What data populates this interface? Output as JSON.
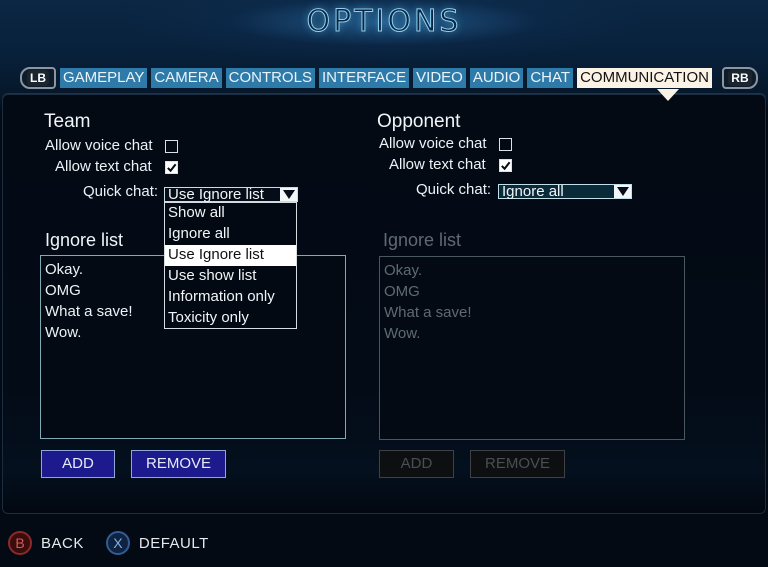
{
  "header": {
    "title": "OPTIONS"
  },
  "tabs": {
    "left_bumper": "LB",
    "right_bumper": "RB",
    "items": [
      {
        "label": "GAMEPLAY",
        "active": false
      },
      {
        "label": "CAMERA",
        "active": false
      },
      {
        "label": "CONTROLS",
        "active": false
      },
      {
        "label": "INTERFACE",
        "active": false
      },
      {
        "label": "VIDEO",
        "active": false
      },
      {
        "label": "AUDIO",
        "active": false
      },
      {
        "label": "CHAT",
        "active": false
      },
      {
        "label": "COMMUNICATION",
        "active": true
      }
    ]
  },
  "team": {
    "title": "Team",
    "allow_voice_chat": {
      "label": "Allow voice chat",
      "checked": false
    },
    "allow_text_chat": {
      "label": "Allow text chat",
      "checked": true
    },
    "quick_chat": {
      "label": "Quick chat:",
      "value": "Use Ignore list",
      "expanded": true,
      "options": [
        "Show all",
        "Ignore all",
        "Use Ignore list",
        "Use show list",
        "Information only",
        "Toxicity only"
      ],
      "selected_index": 2
    },
    "ignore_list": {
      "title": "Ignore list",
      "items": [
        "Okay.",
        "OMG",
        "What a save!",
        "Wow."
      ],
      "enabled": true
    },
    "add_label": "ADD",
    "remove_label": "REMOVE"
  },
  "opponent": {
    "title": "Opponent",
    "allow_voice_chat": {
      "label": "Allow voice chat",
      "checked": false
    },
    "allow_text_chat": {
      "label": "Allow text chat",
      "checked": true
    },
    "quick_chat": {
      "label": "Quick chat:",
      "value": "Ignore all",
      "expanded": false
    },
    "ignore_list": {
      "title": "Ignore list",
      "items": [
        "Okay.",
        "OMG",
        "What a save!",
        "Wow."
      ],
      "enabled": false
    },
    "add_label": "ADD",
    "remove_label": "REMOVE"
  },
  "footer": {
    "back": {
      "button": "B",
      "label": "BACK"
    },
    "default": {
      "button": "X",
      "label": "DEFAULT"
    }
  },
  "colors": {
    "tab_bg": "#2e7aa8",
    "tab_active_bg": "#fbf4e6",
    "button_bg": "#1c1a8c",
    "button_disabled_bg": "#0e0f11"
  }
}
